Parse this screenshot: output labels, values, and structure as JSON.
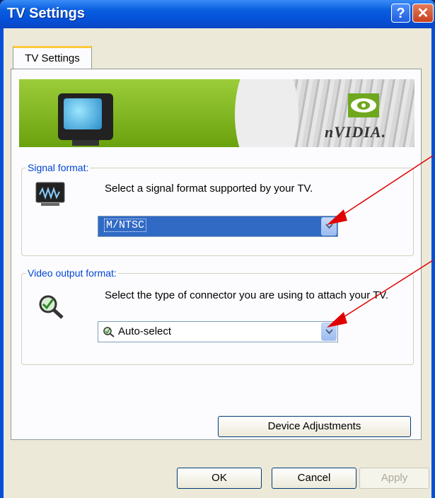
{
  "window": {
    "title": "TV Settings",
    "help_icon": "question-icon",
    "close_icon": "close-icon"
  },
  "tabs": [
    {
      "label": "TV Settings",
      "active": true
    }
  ],
  "banner": {
    "logo_text": "nVIDIA."
  },
  "signal_format": {
    "group_label": "Signal format:",
    "description": "Select a signal format supported by your TV.",
    "selected_value": "M/NTSC",
    "icon": "waveform-icon"
  },
  "video_output_format": {
    "group_label": "Video output format:",
    "description": "Select the type of connector you are using to attach your TV.",
    "selected_value": "Auto-select",
    "icon": "magnifier-check-icon"
  },
  "buttons": {
    "device_adjustments": "Device Adjustments",
    "ok": "OK",
    "cancel": "Cancel",
    "apply": "Apply"
  },
  "colors": {
    "title_bar": "#0550d8",
    "annotation_arrow": "#e00000",
    "selection": "#316ac5"
  }
}
